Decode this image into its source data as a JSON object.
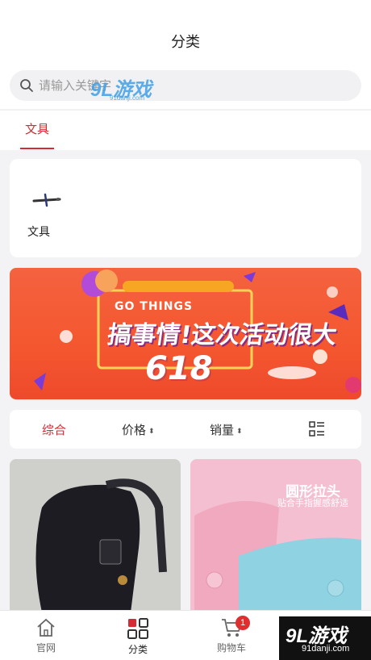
{
  "header": {
    "title": "分类"
  },
  "search": {
    "placeholder": "请输入关键字"
  },
  "tabs": [
    {
      "label": "文具",
      "active": true
    }
  ],
  "categories": [
    {
      "label": "文具",
      "icon": "pen-icon"
    }
  ],
  "banner": {
    "line1": "GO THINGS",
    "line2": "搞事情!这次活动很大",
    "line3": "618"
  },
  "sort": {
    "items": [
      {
        "label": "综合",
        "active": true
      },
      {
        "label": "价格",
        "arrow": "⬍"
      },
      {
        "label": "销量",
        "arrow": "⬍"
      }
    ],
    "view_toggle_icon": "list-view-icon"
  },
  "products": [
    {
      "image": "black-backpack"
    },
    {
      "image": "pink-pencil-case",
      "caption1": "圆形拉头",
      "caption2": "贴合手指握感舒适"
    }
  ],
  "tabbar": {
    "items": [
      {
        "label": "官网",
        "icon": "home-icon"
      },
      {
        "label": "分类",
        "icon": "category-icon",
        "active": true
      },
      {
        "label": "购物车",
        "icon": "cart-icon",
        "badge": "1"
      }
    ]
  },
  "watermark": {
    "logo": "9L游戏",
    "site": "91danji.com"
  },
  "colors": {
    "accent": "#d62b35",
    "background": "#f3f3f5",
    "badge": "#e02e2e"
  }
}
